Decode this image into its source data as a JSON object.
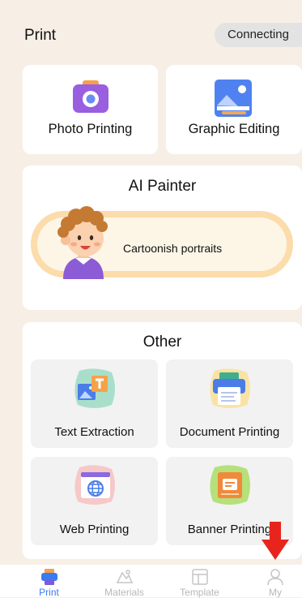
{
  "header": {
    "title": "Print",
    "status": "Connecting"
  },
  "top_cards": [
    {
      "label": "Photo Printing",
      "icon": "camera-icon"
    },
    {
      "label": "Graphic Editing",
      "icon": "picture-icon"
    }
  ],
  "ai_painter": {
    "title": "AI Painter",
    "item_label": "Cartoonish portraits",
    "icon": "cartoon-boy-icon"
  },
  "other": {
    "title": "Other",
    "items": [
      {
        "label": "Text Extraction",
        "icon": "text-extraction-icon"
      },
      {
        "label": "Document Printing",
        "icon": "printer-document-icon"
      },
      {
        "label": "Web Printing",
        "icon": "web-globe-icon"
      },
      {
        "label": "Banner Printing",
        "icon": "banner-icon"
      }
    ]
  },
  "tabs": [
    {
      "label": "Print",
      "active": true
    },
    {
      "label": "Materials",
      "active": false
    },
    {
      "label": "Template",
      "active": false
    },
    {
      "label": "My",
      "active": false
    }
  ],
  "colors": {
    "background": "#f7efe6",
    "active_tab": "#3b7af0",
    "inactive_tab": "#b8b8b8",
    "arrow": "#e8251c"
  }
}
